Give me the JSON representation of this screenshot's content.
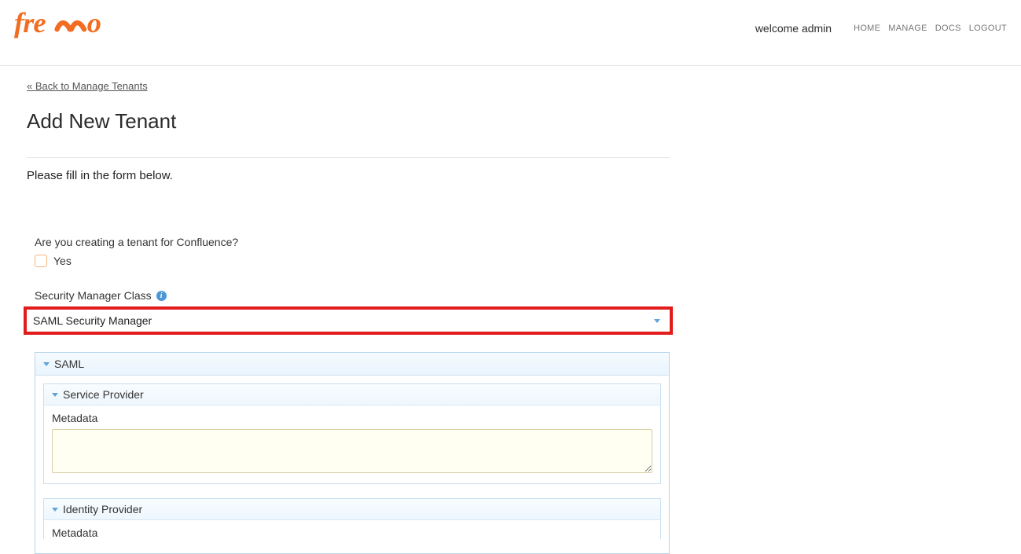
{
  "header": {
    "welcome": "welcome admin",
    "nav": {
      "home": "HOME",
      "manage": "MANAGE",
      "docs": "DOCS",
      "logout": "LOGOUT"
    }
  },
  "page": {
    "back_link": "« Back to Manage Tenants",
    "title": "Add New Tenant",
    "subtitle": "Please fill in the form below."
  },
  "form": {
    "confluence": {
      "question": "Are you creating a tenant for Confluence?",
      "yes_label": "Yes"
    },
    "security_manager": {
      "label": "Security Manager Class",
      "selected": "SAML Security Manager"
    },
    "saml": {
      "panel_title": "SAML",
      "service_provider": {
        "title": "Service Provider",
        "metadata_label": "Metadata",
        "metadata_value": ""
      },
      "identity_provider": {
        "title": "Identity Provider",
        "metadata_label": "Metadata"
      }
    }
  }
}
